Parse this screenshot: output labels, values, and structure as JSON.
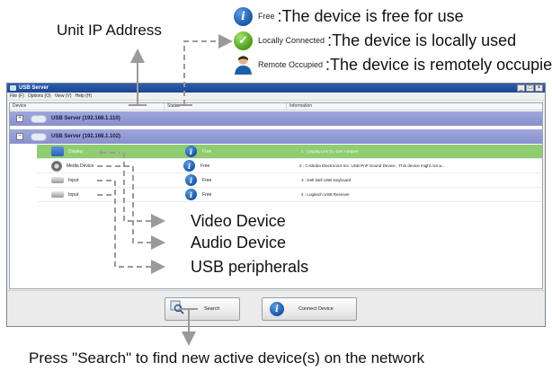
{
  "annotations": {
    "unit_ip": "Unit IP Address",
    "legend": [
      {
        "icon": "info-icon",
        "small": "Free",
        "big": ":The device is free for use"
      },
      {
        "icon": "check-icon",
        "small": "Locally Connected",
        "big": ":The device is locally used"
      },
      {
        "icon": "user-icon",
        "small": "Remote Occupied",
        "big": ":The device is remotely occupied"
      }
    ],
    "video": "Video Device",
    "audio": "Audio Device",
    "usb": "USB peripherals",
    "search_hint": "Press \"Search\" to find new active device(s) on the network"
  },
  "window": {
    "title": "USB Server",
    "controls": {
      "min": "_",
      "max": "□",
      "close": "×"
    },
    "menu": [
      "File (F)",
      "Options (O)",
      "View (V)",
      "Help (H)"
    ],
    "columns": [
      "Device",
      "Status",
      "Information"
    ],
    "servers": [
      {
        "expander": "+",
        "label": "USB Server (192.168.1.110)"
      },
      {
        "expander": "−",
        "label": "USB Server (192.168.1.102)"
      }
    ],
    "devices": [
      {
        "label": "Display",
        "status": "Free",
        "info": "1 : DisplayLink DL-19X Adapter",
        "selected": true
      },
      {
        "label": "Media Device",
        "status": "Free",
        "info": "2 : C-Media Electronics Inc.     USB PnP Sound Device     , This device might not w...",
        "selected": false
      },
      {
        "label": "Input",
        "status": "Free",
        "info": "3 : Dell Dell USB Keyboard",
        "selected": false
      },
      {
        "label": "Input",
        "status": "Free",
        "info": "4 : Logitech USB Receiver",
        "selected": false
      }
    ],
    "buttons": {
      "search": "Search",
      "connect": "Connect Device"
    }
  },
  "colors": {
    "server_row": "#8f98d2",
    "selected_row": "#8fcc72",
    "titlebar": "#2556a3",
    "arrow": "#9a9a9a"
  }
}
